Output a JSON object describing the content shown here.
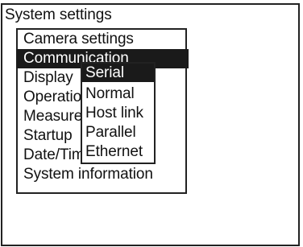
{
  "window": {
    "title": "System settings"
  },
  "menu": {
    "items": [
      {
        "label": "Camera settings",
        "selected": false
      },
      {
        "label": "Communication",
        "selected": true
      },
      {
        "label": "Display",
        "selected": false
      },
      {
        "label": "Operation s",
        "selected": false
      },
      {
        "label": "Measure control",
        "selected": false
      },
      {
        "label": "Startup",
        "selected": false
      },
      {
        "label": "Date/Time",
        "selected": false
      },
      {
        "label": "System information",
        "selected": false
      }
    ]
  },
  "submenu": {
    "items": [
      {
        "label": "Serial",
        "selected": true
      },
      {
        "label": "Normal",
        "selected": false
      },
      {
        "label": "Host link",
        "selected": false
      },
      {
        "label": "Parallel",
        "selected": false
      },
      {
        "label": "Ethernet",
        "selected": false
      }
    ]
  },
  "colors": {
    "highlight": "#1a1a1a",
    "highlight_text": "#ffffff",
    "border": "#222222",
    "background": "#ffffff"
  }
}
